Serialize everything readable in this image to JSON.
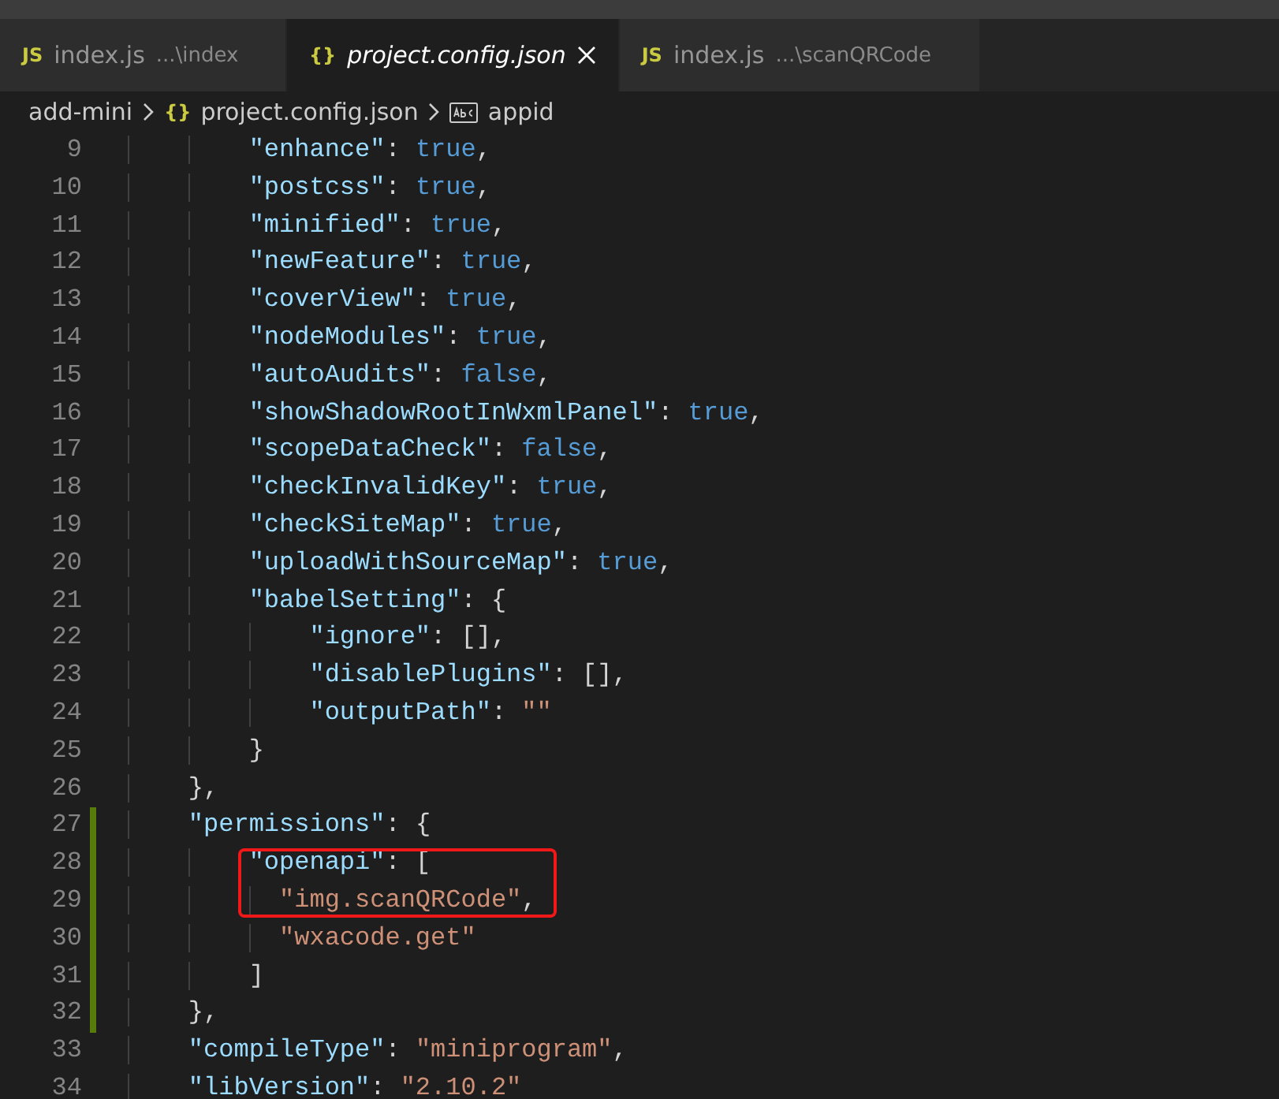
{
  "tabs": [
    {
      "icon_text": "JS",
      "label": "index.js",
      "path": "...\\index",
      "selected": false
    },
    {
      "icon_text": "{}",
      "label": "project.config.json",
      "selected": true
    },
    {
      "icon_text": "JS",
      "label": "index.js",
      "path": "...\\scanQRCode",
      "selected": false
    }
  ],
  "breadcrumb": [
    {
      "kind": "folder",
      "label": "add-mini"
    },
    {
      "kind": "json",
      "icon_text": "{}",
      "label": "project.config.json"
    },
    {
      "kind": "string-property",
      "label": "appid"
    }
  ],
  "lines": [
    {
      "number": "9",
      "code": "        \"enhance\": true,",
      "modified": false,
      "highlighted": false
    },
    {
      "number": "10",
      "code": "        \"postcss\": true,",
      "modified": false,
      "highlighted": false
    },
    {
      "number": "11",
      "code": "        \"minified\": true,",
      "modified": false,
      "highlighted": false
    },
    {
      "number": "12",
      "code": "        \"newFeature\": true,",
      "modified": false,
      "highlighted": false
    },
    {
      "number": "13",
      "code": "        \"coverView\": true,",
      "modified": false,
      "highlighted": false
    },
    {
      "number": "14",
      "code": "        \"nodeModules\": true,",
      "modified": false,
      "highlighted": false
    },
    {
      "number": "15",
      "code": "        \"autoAudits\": false,",
      "modified": false,
      "highlighted": false
    },
    {
      "number": "16",
      "code": "        \"showShadowRootInWxmlPanel\": true,",
      "modified": false,
      "highlighted": false
    },
    {
      "number": "17",
      "code": "        \"scopeDataCheck\": false,",
      "modified": false,
      "highlighted": false
    },
    {
      "number": "18",
      "code": "        \"checkInvalidKey\": true,",
      "modified": false,
      "highlighted": false
    },
    {
      "number": "19",
      "code": "        \"checkSiteMap\": true,",
      "modified": false,
      "highlighted": false
    },
    {
      "number": "20",
      "code": "        \"uploadWithSourceMap\": true,",
      "modified": false,
      "highlighted": false
    },
    {
      "number": "21",
      "code": "        \"babelSetting\": {",
      "modified": false,
      "highlighted": false
    },
    {
      "number": "22",
      "code": "            \"ignore\": [],",
      "modified": false,
      "highlighted": false
    },
    {
      "number": "23",
      "code": "            \"disablePlugins\": [],",
      "modified": false,
      "highlighted": false
    },
    {
      "number": "24",
      "code": "            \"outputPath\": \"\"",
      "modified": false,
      "highlighted": false
    },
    {
      "number": "25",
      "code": "        }",
      "modified": false,
      "highlighted": false
    },
    {
      "number": "26",
      "code": "    },",
      "modified": false,
      "highlighted": false
    },
    {
      "number": "27",
      "code": "    \"permissions\": {",
      "modified": true,
      "highlighted": false
    },
    {
      "number": "28",
      "code": "        \"openapi\": [",
      "modified": true,
      "highlighted": true
    },
    {
      "number": "29",
      "code": "          \"img.scanQRCode\",",
      "modified": true,
      "highlighted": true
    },
    {
      "number": "30",
      "code": "          \"wxacode.get\"",
      "modified": true,
      "highlighted": false
    },
    {
      "number": "31",
      "code": "        ]",
      "modified": true,
      "highlighted": false
    },
    {
      "number": "32",
      "code": "    },",
      "modified": true,
      "highlighted": false
    },
    {
      "number": "33",
      "code": "    \"compileType\": \"miniprogram\",",
      "modified": false,
      "highlighted": false
    },
    {
      "number": "34",
      "code": "    \"libVersion\": \"2.10.2\"",
      "modified": false,
      "highlighted": false
    }
  ]
}
